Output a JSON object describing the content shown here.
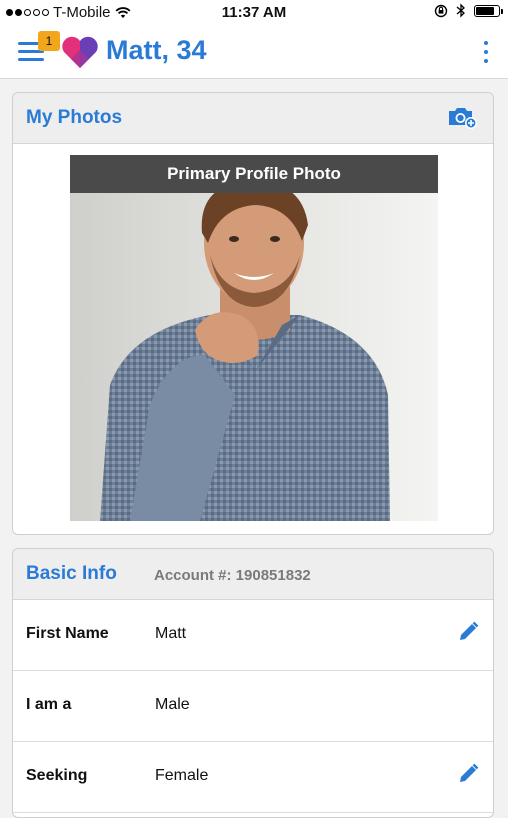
{
  "status_bar": {
    "carrier": "T-Mobile",
    "time": "11:37 AM",
    "battery_level": 0.85
  },
  "header": {
    "title": "Matt, 34",
    "notification_count": "1"
  },
  "photos": {
    "title": "My Photos",
    "primary_label": "Primary Profile Photo"
  },
  "basic_info": {
    "title": "Basic Info",
    "account": "Account #: 190851832",
    "rows": [
      {
        "label": "First Name",
        "value": "Matt",
        "editable": true
      },
      {
        "label": "I am a",
        "value": "Male",
        "editable": false
      },
      {
        "label": "Seeking",
        "value": "Female",
        "editable": true
      }
    ]
  },
  "colors": {
    "accent": "#2a7bd6",
    "badge": "#f2a61b",
    "logo_pink": "#e3307a",
    "logo_purple": "#6a3fb5"
  },
  "icons": [
    "wifi-icon",
    "lock-rotation-icon",
    "bluetooth-icon",
    "battery-icon",
    "menu-icon",
    "app-logo-icon",
    "more-options-icon",
    "add-photo-camera-icon",
    "edit-pencil-icon"
  ]
}
